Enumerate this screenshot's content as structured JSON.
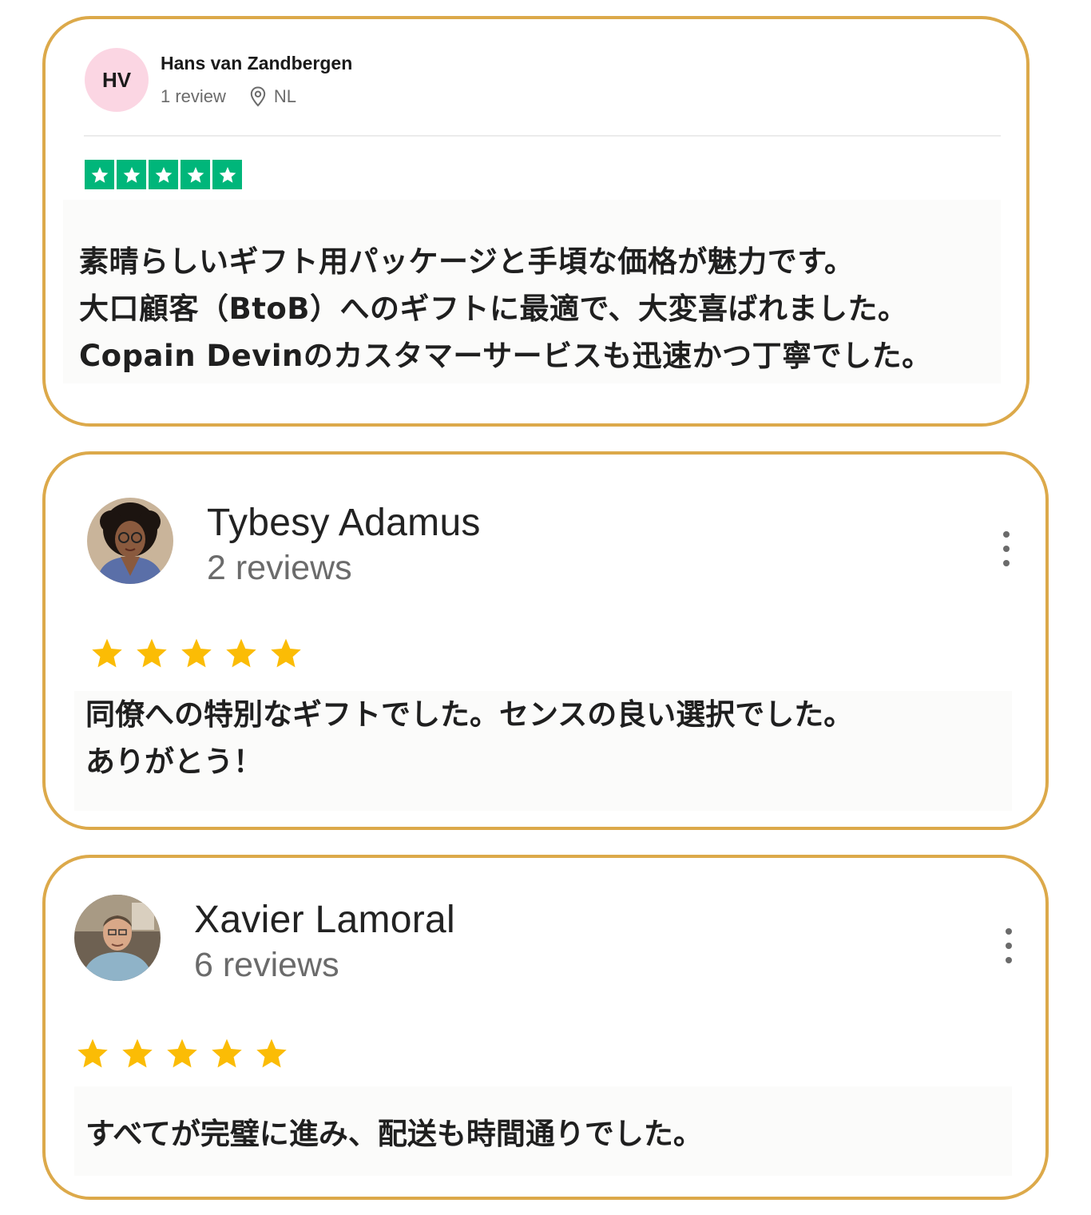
{
  "colors": {
    "card_border": "#dca94a",
    "trustpilot_green": "#00b67a",
    "google_star": "#fbbc05",
    "avatar_pink": "#fbd6e3"
  },
  "reviews": [
    {
      "initials": "HV",
      "name": "Hans van Zandbergen",
      "review_count": "1 review",
      "location": "NL",
      "rating": 5,
      "text": "素晴らしいギフト用パッケージと手頃な価格が魅力です。\n大口顧客（BtoB）へのギフトに最適で、大変喜ばれました。\nCopain Devinのカスタマーサービスも迅速かつ丁寧でした。"
    },
    {
      "name": "Tybesy Adamus",
      "review_count": "2 reviews",
      "rating": 5,
      "text": "同僚への特別なギフトでした。センスの良い選択でした。\nありがとう！"
    },
    {
      "name": "Xavier Lamoral",
      "review_count": "6 reviews",
      "rating": 5,
      "text": "すべてが完璧に進み、配送も時間通りでした。"
    }
  ]
}
